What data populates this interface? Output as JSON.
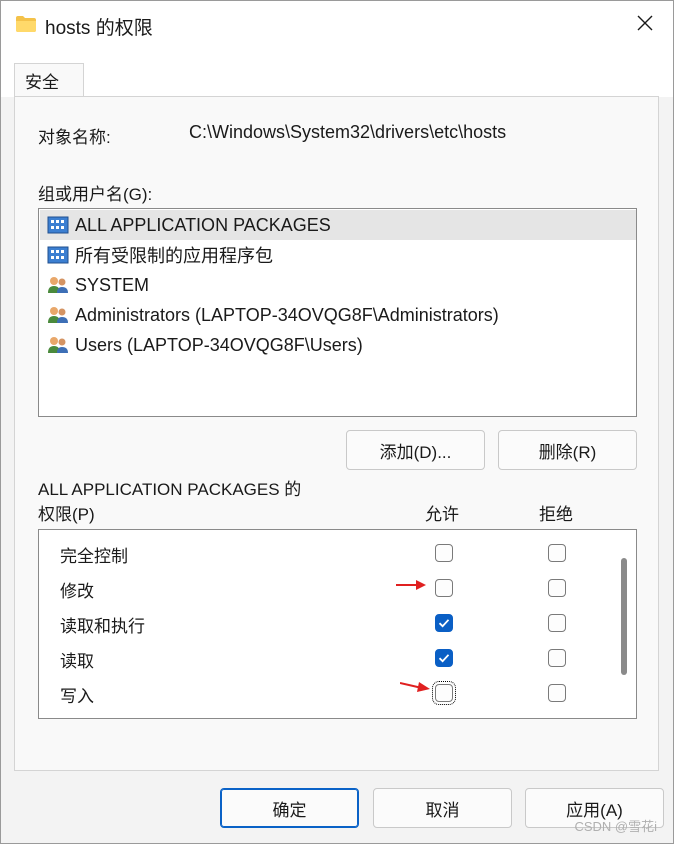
{
  "window": {
    "title": "hosts 的权限",
    "icons": {
      "folder": "folder-icon",
      "close": "close-icon"
    }
  },
  "tabs": [
    {
      "label": "安全",
      "selected": true
    }
  ],
  "object": {
    "label": "对象名称:",
    "value": "C:\\Windows\\System32\\drivers\\etc\\hosts"
  },
  "groups": {
    "label": "组或用户名(G):",
    "items": [
      {
        "label": "ALL APPLICATION PACKAGES",
        "icon": "package-group-icon",
        "selected": true
      },
      {
        "label": "所有受限制的应用程序包",
        "icon": "package-group-icon",
        "selected": false
      },
      {
        "label": "SYSTEM",
        "icon": "users-icon",
        "selected": false
      },
      {
        "label": "Administrators (LAPTOP-34OVQG8F\\Administrators)",
        "icon": "users-icon",
        "selected": false
      },
      {
        "label": "Users (LAPTOP-34OVQG8F\\Users)",
        "icon": "users-icon",
        "selected": false
      }
    ],
    "add_button": "添加(D)...",
    "remove_button": "删除(R)"
  },
  "permissions": {
    "title_line1": "ALL APPLICATION PACKAGES 的",
    "title_line2": "权限(P)",
    "allow_header": "允许",
    "deny_header": "拒绝",
    "rows": [
      {
        "name": "完全控制",
        "allow": false,
        "deny": false
      },
      {
        "name": "修改",
        "allow": false,
        "deny": false
      },
      {
        "name": "读取和执行",
        "allow": true,
        "deny": false
      },
      {
        "name": "读取",
        "allow": true,
        "deny": false
      },
      {
        "name": "写入",
        "allow": false,
        "deny": false
      }
    ]
  },
  "footer": {
    "ok": "确定",
    "cancel": "取消",
    "apply": "应用(A)"
  },
  "watermark": "CSDN @雪花i",
  "colors": {
    "accent": "#0a5fc5",
    "annotation_arrow": "#e02020"
  }
}
